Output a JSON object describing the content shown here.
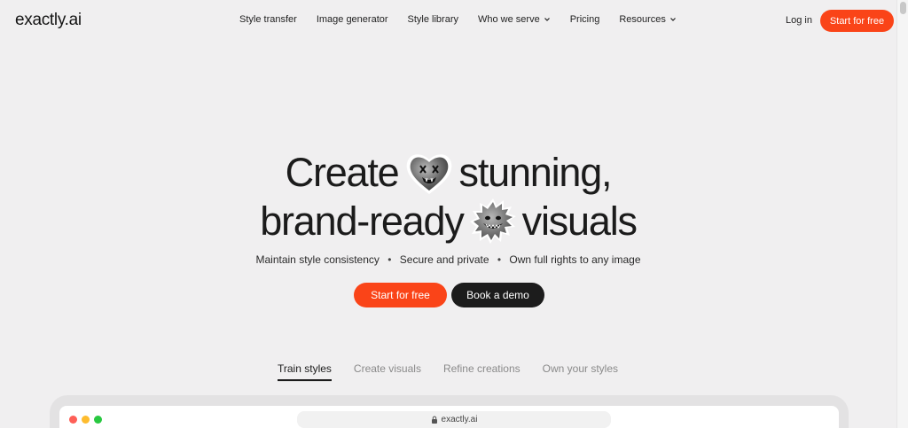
{
  "header": {
    "logo": "exactly.ai",
    "nav": [
      {
        "label": "Style transfer",
        "dropdown": false
      },
      {
        "label": "Image generator",
        "dropdown": false
      },
      {
        "label": "Style library",
        "dropdown": false
      },
      {
        "label": "Who we serve",
        "dropdown": true
      },
      {
        "label": "Pricing",
        "dropdown": false
      },
      {
        "label": "Resources",
        "dropdown": true
      }
    ],
    "login": "Log in",
    "cta": "Start for free"
  },
  "hero": {
    "line1_a": "Create",
    "line1_b": "stunning,",
    "line2_a": "brand-ready",
    "line2_b": "visuals",
    "emoji1": "heart-face-icon",
    "emoji2": "fuzzy-monster-icon",
    "features": [
      "Maintain style consistency",
      "Secure and private",
      "Own full rights to any image"
    ],
    "primary_cta": "Start for free",
    "secondary_cta": "Book a demo"
  },
  "tabs": [
    {
      "label": "Train styles",
      "active": true
    },
    {
      "label": "Create visuals",
      "active": false
    },
    {
      "label": "Refine creations",
      "active": false
    },
    {
      "label": "Own your styles",
      "active": false
    }
  ],
  "browser_mock": {
    "url": "exactly.ai"
  },
  "colors": {
    "accent": "#fa4418",
    "dark_button": "#1c1c1c",
    "background": "#f0eff0"
  }
}
